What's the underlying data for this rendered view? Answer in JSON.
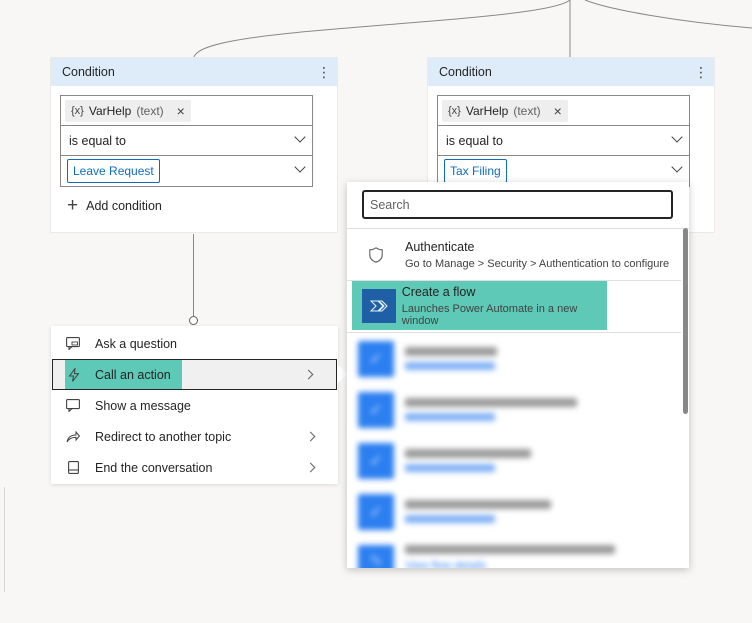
{
  "conditions": [
    {
      "header": "Condition",
      "variable": {
        "glyph": "{x}",
        "name": "VarHelp",
        "type": "(text)"
      },
      "operator": "is equal to",
      "value": "Leave Request",
      "add_label": "Add condition"
    },
    {
      "header": "Condition",
      "variable": {
        "glyph": "{x}",
        "name": "VarHelp",
        "type": "(text)"
      },
      "operator": "is equal to",
      "value": "Tax Filing"
    }
  ],
  "menu": {
    "items": [
      {
        "label": "Ask a question",
        "icon": "ask-question-icon"
      },
      {
        "label": "Call an action",
        "icon": "lightning-icon",
        "selected": true
      },
      {
        "label": "Show a message",
        "icon": "message-icon"
      },
      {
        "label": "Redirect to another topic",
        "icon": "redirect-icon"
      },
      {
        "label": "End the conversation",
        "icon": "end-conversation-icon"
      }
    ]
  },
  "flyout": {
    "search_placeholder": "Search",
    "authenticate": {
      "title": "Authenticate",
      "subtitle": "Go to Manage > Security > Authentication to configure",
      "icon": "shield-icon"
    },
    "create_flow": {
      "title": "Create a flow",
      "subtitle": "Launches Power Automate in a new window",
      "icon": "power-automate-icon"
    },
    "partial_link": "View flow details"
  },
  "colors": {
    "header_bg": "#deecf9",
    "highlight": "#5ec9b6",
    "link": "#0f6cbd",
    "tile": "#2c7ff0"
  }
}
